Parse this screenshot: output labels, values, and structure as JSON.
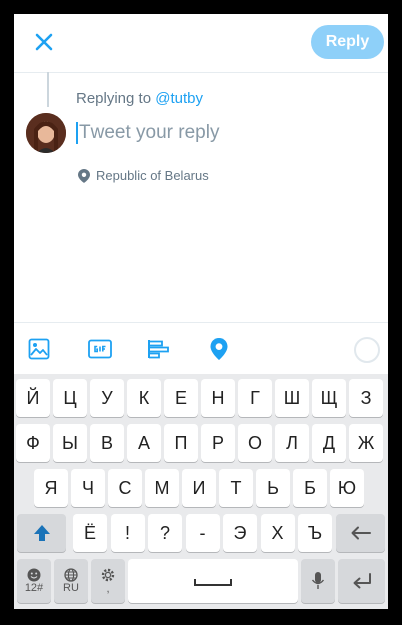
{
  "header": {
    "reply_label": "Reply"
  },
  "compose": {
    "replying_prefix": "Replying to ",
    "replying_handle": "@tutby",
    "placeholder_caret": "T",
    "placeholder": "weet your reply",
    "location": "Republic of Belarus"
  },
  "colors": {
    "accent": "#1da1f2",
    "reply_button": "#8ed0f9"
  },
  "toolbar": {
    "icons": [
      "image-icon",
      "gif-icon",
      "poll-icon",
      "location-icon"
    ]
  },
  "keyboard": {
    "row1": [
      "Й",
      "Ц",
      "У",
      "К",
      "Е",
      "Н",
      "Г",
      "Ш",
      "Щ",
      "З"
    ],
    "row2": [
      "Ф",
      "Ы",
      "В",
      "А",
      "П",
      "Р",
      "О",
      "Л",
      "Д",
      "Ж"
    ],
    "row3": [
      "Я",
      "Ч",
      "С",
      "М",
      "И",
      "Т",
      "Ь",
      "Б",
      "Ю"
    ],
    "row4": [
      "Ё",
      "!",
      "?",
      "-",
      "Э",
      "Х",
      "Ъ"
    ],
    "emoji_sub": "12#",
    "lang_sub": "RU",
    "settings_sub": ","
  }
}
